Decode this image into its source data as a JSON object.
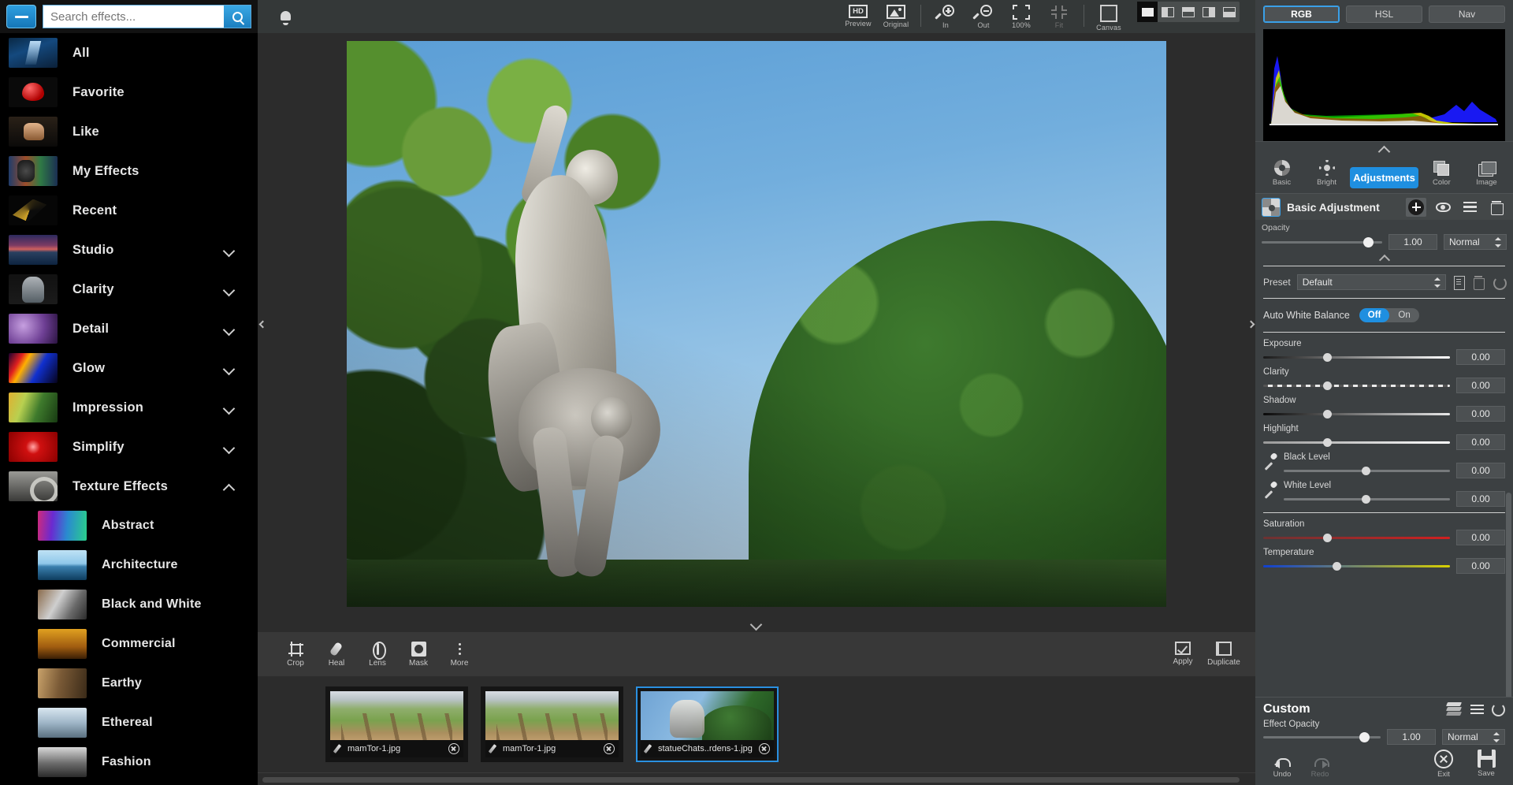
{
  "search": {
    "placeholder": "Search effects...",
    "value": ""
  },
  "sidebar": {
    "items": [
      {
        "label": "All",
        "thumb": "t-all",
        "chevron": "",
        "sub": false
      },
      {
        "label": "Favorite",
        "thumb": "t-fav",
        "chevron": "",
        "sub": false
      },
      {
        "label": "Like",
        "thumb": "t-like",
        "chevron": "",
        "sub": false
      },
      {
        "label": "My Effects",
        "thumb": "t-myeffects",
        "chevron": "",
        "sub": false
      },
      {
        "label": "Recent",
        "thumb": "t-recent",
        "chevron": "",
        "sub": false
      },
      {
        "label": "Studio",
        "thumb": "t-studio",
        "chevron": "down",
        "sub": false
      },
      {
        "label": "Clarity",
        "thumb": "t-clarity",
        "chevron": "down",
        "sub": false
      },
      {
        "label": "Detail",
        "thumb": "t-detail",
        "chevron": "down",
        "sub": false
      },
      {
        "label": "Glow",
        "thumb": "t-glow",
        "chevron": "down",
        "sub": false
      },
      {
        "label": "Impression",
        "thumb": "t-impression",
        "chevron": "down",
        "sub": false
      },
      {
        "label": "Simplify",
        "thumb": "t-simplify",
        "chevron": "down",
        "sub": false
      },
      {
        "label": "Texture Effects",
        "thumb": "t-texture",
        "chevron": "up",
        "sub": false
      },
      {
        "label": "Abstract",
        "thumb": "t-abstract",
        "chevron": "",
        "sub": true
      },
      {
        "label": "Architecture",
        "thumb": "t-architecture",
        "chevron": "",
        "sub": true
      },
      {
        "label": "Black and White",
        "thumb": "t-bw",
        "chevron": "",
        "sub": true
      },
      {
        "label": "Commercial",
        "thumb": "t-commercial",
        "chevron": "",
        "sub": true
      },
      {
        "label": "Earthy",
        "thumb": "t-earthy",
        "chevron": "",
        "sub": true
      },
      {
        "label": "Ethereal",
        "thumb": "t-ethereal",
        "chevron": "",
        "sub": true
      },
      {
        "label": "Fashion",
        "thumb": "t-fashion",
        "chevron": "",
        "sub": true
      }
    ]
  },
  "topbar": {
    "tools": [
      {
        "label": "Preview",
        "icon": "hd-icon"
      },
      {
        "label": "Original",
        "icon": "original-image-icon"
      },
      {
        "label": "In",
        "icon": "zoom-in-icon"
      },
      {
        "label": "Out",
        "icon": "zoom-out-icon"
      },
      {
        "label": "100%",
        "icon": "actual-size-icon"
      },
      {
        "label": "Fit",
        "icon": "fit-to-screen-icon"
      },
      {
        "label": "Canvas",
        "icon": "canvas-icon"
      }
    ]
  },
  "tools": {
    "items": [
      {
        "label": "Crop",
        "icon": "crop-icon"
      },
      {
        "label": "Heal",
        "icon": "heal-icon"
      },
      {
        "label": "Lens",
        "icon": "lens-icon"
      },
      {
        "label": "Mask",
        "icon": "mask-icon"
      },
      {
        "label": "More",
        "icon": "more-icon"
      }
    ],
    "apply_label": "Apply",
    "duplicate_label": "Duplicate"
  },
  "filmstrip": {
    "items": [
      {
        "name": "mamTor-1.jpg",
        "art": "f-mam",
        "selected": false
      },
      {
        "name": "mamTor-1.jpg",
        "art": "f-mam",
        "selected": false
      },
      {
        "name": "statueChats..rdens-1.jpg",
        "art": "f-statue",
        "selected": true
      }
    ]
  },
  "right": {
    "histogram_tabs": [
      {
        "label": "RGB",
        "active": true
      },
      {
        "label": "HSL",
        "active": false
      },
      {
        "label": "Nav",
        "active": false
      }
    ],
    "adjust_tabs": [
      {
        "label": "Basic",
        "icon": "aperture-icon",
        "active": false
      },
      {
        "label": "Bright",
        "icon": "brightness-icon",
        "active": false
      },
      {
        "label": "Adjustments",
        "icon": "",
        "active": true
      },
      {
        "label": "Color",
        "icon": "color-layers-icon",
        "active": false
      },
      {
        "label": "Image",
        "icon": "images-icon",
        "active": false
      }
    ],
    "layer": {
      "name": "Basic Adjustment",
      "opacity_label": "Opacity",
      "opacity_value": "1.00",
      "blend_mode": "Normal"
    },
    "preset": {
      "label": "Preset",
      "value": "Default"
    },
    "auto_white_balance": {
      "label": "Auto White Balance",
      "off": "Off",
      "on": "On",
      "selected": "Off"
    },
    "sliders": [
      {
        "name": "Exposure",
        "value": "0.00",
        "track": "tr-exposure",
        "pos": 32,
        "eyedropper": false
      },
      {
        "name": "Clarity",
        "value": "0.00",
        "track": "tr-clarity",
        "pos": 32,
        "eyedropper": false
      },
      {
        "name": "Shadow",
        "value": "0.00",
        "track": "tr-shadow",
        "pos": 32,
        "eyedropper": false
      },
      {
        "name": "Highlight",
        "value": "0.00",
        "track": "tr-highlight",
        "pos": 32,
        "eyedropper": false
      },
      {
        "name": "Black Level",
        "value": "0.00",
        "track": "tr-plain",
        "pos": 47,
        "eyedropper": true
      },
      {
        "name": "White Level",
        "value": "0.00",
        "track": "tr-plain",
        "pos": 47,
        "eyedropper": true
      }
    ],
    "sliders2": [
      {
        "name": "Saturation",
        "value": "0.00",
        "track": "tr-sat",
        "pos": 32,
        "eyedropper": false
      },
      {
        "name": "Temperature",
        "value": "0.00",
        "track": "tr-temp",
        "pos": 37,
        "eyedropper": false
      }
    ],
    "custom": {
      "title": "Custom",
      "effect_opacity_label": "Effect Opacity",
      "effect_opacity_value": "1.00",
      "blend_mode": "Normal",
      "undo_label": "Undo",
      "redo_label": "Redo",
      "exit_label": "Exit",
      "save_label": "Save"
    }
  },
  "colors": {
    "accent": "#1f8fe0",
    "panel": "#3c4042",
    "sidebar": "#000000",
    "canvas": "#2c2c2c"
  }
}
